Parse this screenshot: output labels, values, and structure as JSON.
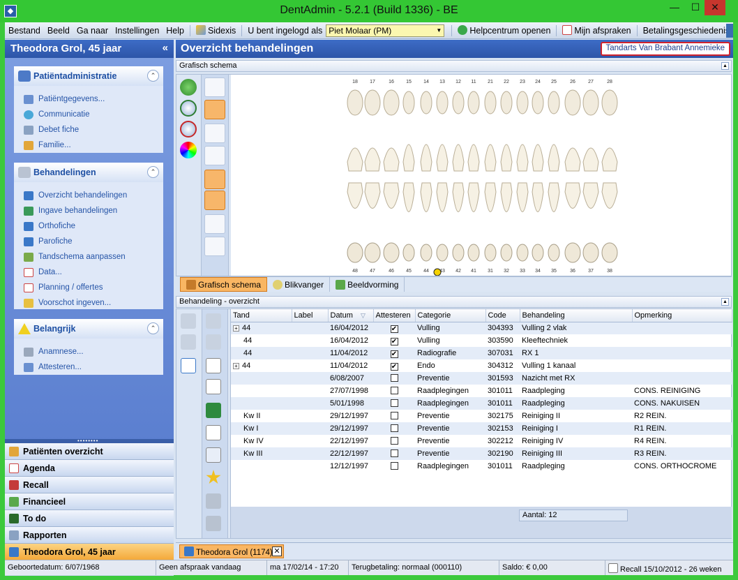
{
  "window": {
    "title": "DentAdmin - 5.2.1     (Build 1336) - BE"
  },
  "menu": {
    "items": [
      "Bestand",
      "Beeld",
      "Ga naar",
      "Instellingen",
      "Help"
    ],
    "sidexis": "Sidexis",
    "logged_in_label": "U bent ingelogd als",
    "user": "Piet Molaar (PM)",
    "help_center": "Helpcentrum openen",
    "appointments": "Mijn afspraken",
    "payment_history": "Betalingsgeschiedenis"
  },
  "patient": {
    "title": "Theodora Grol, 45 jaar"
  },
  "nav": {
    "groups": [
      {
        "title": "Patiëntadministratie",
        "items": [
          "Patiëntgegevens...",
          "Communicatie",
          "Debet fiche",
          "Familie..."
        ]
      },
      {
        "title": "Behandelingen",
        "items": [
          "Overzicht behandelingen",
          "Ingave behandelingen",
          "Orthofiche",
          "Parofiche",
          "Tandschema aanpassen",
          "Data...",
          "Planning / offertes",
          "Voorschot ingeven..."
        ]
      },
      {
        "title": "Belangrijk",
        "items": [
          "Anamnese...",
          "Attesteren..."
        ]
      }
    ],
    "buttons": [
      "Patiënten overzicht",
      "Agenda",
      "Recall",
      "Financieel",
      "To do",
      "Rapporten",
      "Theodora Grol, 45 jaar"
    ],
    "more": "»"
  },
  "main": {
    "title": "Overzicht behandelingen",
    "dentist": "Tandarts Van Brabant Annemieke",
    "schema_panel": "Grafisch schema",
    "overview_panel": "Behandeling - overzicht",
    "schema_tabs": [
      "Grafisch schema",
      "Blikvanger",
      "Beeldvorming"
    ]
  },
  "teeth": {
    "upper": [
      "18",
      "17",
      "16",
      "15",
      "14",
      "13",
      "12",
      "11",
      "21",
      "22",
      "23",
      "24",
      "25",
      "26",
      "27",
      "28"
    ],
    "lower": [
      "48",
      "47",
      "46",
      "45",
      "44",
      "43",
      "42",
      "41",
      "31",
      "32",
      "33",
      "34",
      "35",
      "36",
      "37",
      "38"
    ]
  },
  "grid": {
    "columns": [
      "Tand",
      "Label",
      "Datum",
      "Attesteren",
      "Categorie",
      "Code",
      "Behandeling",
      "Opmerking"
    ],
    "rows": [
      {
        "exp": true,
        "tand": "44",
        "label": "",
        "datum": "16/04/2012",
        "att": true,
        "cat": "Vulling",
        "code": "304393",
        "beh": "Vulling 2 vlak",
        "opm": ""
      },
      {
        "exp": false,
        "tand": "44",
        "label": "",
        "datum": "16/04/2012",
        "att": true,
        "cat": "Vulling",
        "code": "303590",
        "beh": "Kleeftechniek",
        "opm": ""
      },
      {
        "exp": false,
        "tand": "44",
        "label": "",
        "datum": "11/04/2012",
        "att": true,
        "cat": "Radiografie",
        "code": "307031",
        "beh": "RX 1",
        "opm": ""
      },
      {
        "exp": true,
        "tand": "44",
        "label": "",
        "datum": "11/04/2012",
        "att": true,
        "cat": "Endo",
        "code": "304312",
        "beh": "Vulling 1 kanaal",
        "opm": ""
      },
      {
        "exp": false,
        "tand": "",
        "label": "",
        "datum": "6/08/2007",
        "att": false,
        "cat": "Preventie",
        "code": "301593",
        "beh": "Nazicht met RX",
        "opm": ""
      },
      {
        "exp": false,
        "tand": "",
        "label": "",
        "datum": "27/07/1998",
        "att": false,
        "cat": "Raadplegingen",
        "code": "301011",
        "beh": "Raadpleging",
        "opm": "CONS. REINIGING"
      },
      {
        "exp": false,
        "tand": "",
        "label": "",
        "datum": "5/01/1998",
        "att": false,
        "cat": "Raadplegingen",
        "code": "301011",
        "beh": "Raadpleging",
        "opm": "CONS. NAKUISEN"
      },
      {
        "exp": false,
        "tand": "Kw II",
        "label": "",
        "datum": "29/12/1997",
        "att": false,
        "cat": "Preventie",
        "code": "302175",
        "beh": "Reiniging II",
        "opm": "R2  REIN."
      },
      {
        "exp": false,
        "tand": "Kw I",
        "label": "",
        "datum": "29/12/1997",
        "att": false,
        "cat": "Preventie",
        "code": "302153",
        "beh": "Reiniging I",
        "opm": "R1  REIN."
      },
      {
        "exp": false,
        "tand": "Kw IV",
        "label": "",
        "datum": "22/12/1997",
        "att": false,
        "cat": "Preventie",
        "code": "302212",
        "beh": "Reiniging IV",
        "opm": "R4  REIN."
      },
      {
        "exp": false,
        "tand": "Kw III",
        "label": "",
        "datum": "22/12/1997",
        "att": false,
        "cat": "Preventie",
        "code": "302190",
        "beh": "Reiniging III",
        "opm": "R3  REIN."
      },
      {
        "exp": false,
        "tand": "",
        "label": "",
        "datum": "12/12/1997",
        "att": false,
        "cat": "Raadplegingen",
        "code": "301011",
        "beh": "Raadpleging",
        "opm": "CONS. ORTHOCROME"
      }
    ],
    "count": "Aantal: 12"
  },
  "doc_tab": "Theodora Grol (1174)",
  "status": {
    "birth": "Geboortedatum: 6/07/1968",
    "appointment": "Geen afspraak vandaag",
    "datetime": "ma 17/02/14 - 17:20",
    "refund": "Terugbetaling: normaal (000110)",
    "balance": "Saldo: € 0,00",
    "recall": "Recall 15/10/2012 - 26 weken"
  }
}
